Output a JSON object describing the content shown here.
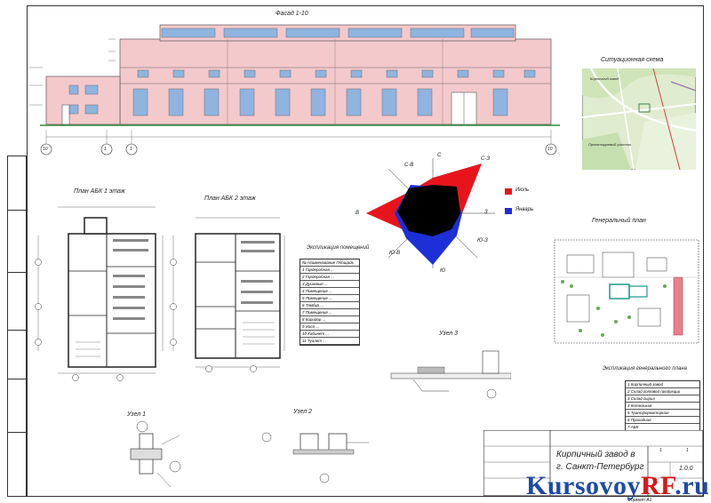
{
  "facade": {
    "title": "Фасад 1-10"
  },
  "axes": {
    "a1": "10",
    "a2": "1",
    "a3": "1",
    "a4": "10"
  },
  "situation": {
    "title": "Ситуационная схема",
    "label1": "Кирпичный завод",
    "label2": "Проектируемый участок"
  },
  "wind": {
    "labels": {
      "n": "С",
      "ne": "С-З",
      "e": "З",
      "se": "Ю-З",
      "s": "Ю",
      "sw": "Ю-В",
      "w": "В",
      "nw": "С-В"
    },
    "legend_july": "Июль",
    "legend_jan": "Январь",
    "color_july": "#e8141c",
    "color_jan": "#1d2fd6",
    "color_core": "#000000"
  },
  "plan1": {
    "title": "План АБК 1 этаж"
  },
  "plan2": {
    "title": "План АБК 2 этаж"
  },
  "genplan": {
    "title": "Генеральный план",
    "explication_title": "Экспликация генерального плана"
  },
  "explication": {
    "title": "Экспликация помещений",
    "header": [
      "№",
      "Наименование",
      "Площадь"
    ],
    "rows": [
      [
        "1",
        "Гардеробная",
        "..."
      ],
      [
        "2",
        "Гардеробная",
        "..."
      ],
      [
        "3",
        "Душевые",
        "..."
      ],
      [
        "4",
        "Помещение",
        "..."
      ],
      [
        "5",
        "Помещение",
        "..."
      ],
      [
        "6",
        "Тамбур",
        "..."
      ],
      [
        "7",
        "Помещение",
        "..."
      ],
      [
        "8",
        "Коридор",
        "..."
      ],
      [
        "9",
        "Холл",
        "..."
      ],
      [
        "10",
        "Кабинет",
        "..."
      ],
      [
        "11",
        "Туалет",
        "..."
      ]
    ]
  },
  "genplan_expl": {
    "rows": [
      "Кирпичный завод",
      "Склад готовой продукции",
      "Склад сырья",
      "Котельная",
      "Трансформаторная",
      "Проходная",
      "АБК"
    ]
  },
  "nodes": {
    "n1": "Узел 1",
    "n2": "Узел 2",
    "n3": "Узел 3"
  },
  "stamp": {
    "title_line1": "Кирпичный завод в",
    "title_line2": "г. Санкт-Петербург",
    "sheet_no": "1",
    "sheets": "1",
    "code": "1.0.0",
    "format": "Формат А1"
  },
  "watermark": {
    "part1": "Kursovoy",
    "part2": "RF",
    "part3": ".ru"
  }
}
